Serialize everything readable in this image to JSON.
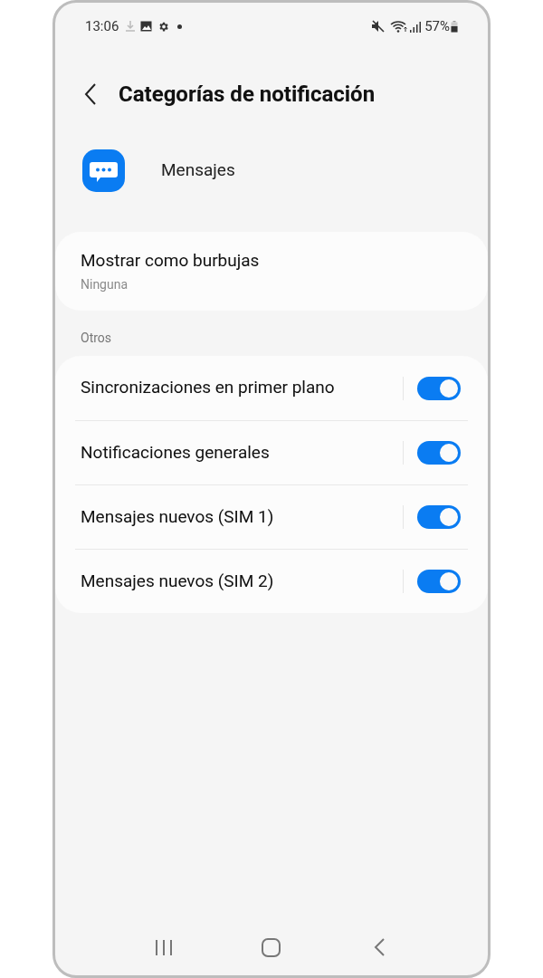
{
  "status_bar": {
    "time": "13:06",
    "battery": "57%"
  },
  "header": {
    "title": "Categorías de notificación"
  },
  "app": {
    "name": "Mensajes"
  },
  "bubbles": {
    "title": "Mostrar como burbujas",
    "value": "Ninguna"
  },
  "section": {
    "title": "Otros"
  },
  "categories": [
    {
      "label": "Sincronizaciones en primer plano",
      "on": true
    },
    {
      "label": "Notificaciones generales",
      "on": true
    },
    {
      "label": "Mensajes nuevos (SIM 1)",
      "on": true
    },
    {
      "label": "Mensajes nuevos (SIM 2)",
      "on": true
    }
  ]
}
